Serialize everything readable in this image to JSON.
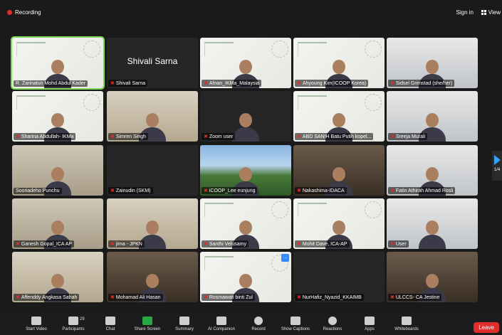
{
  "topbar": {
    "recording_label": "Recording",
    "signin_label": "Sign in",
    "view_label": "View"
  },
  "gallery": {
    "page_indicator": "1/4",
    "participants": [
      {
        "name": "R. Zarinatun Mohd Abdul Kader",
        "bg": "slide",
        "muted": false,
        "active": true
      },
      {
        "name": "Shivali Sarna",
        "bg": "dark",
        "muted": true,
        "big": "Shivali Sarna"
      },
      {
        "name": "Afnan_IKMa_Malaysia",
        "bg": "slide",
        "muted": true
      },
      {
        "name": "Ahyoung Kim(ICOOP Korea)",
        "bg": "slide",
        "muted": true
      },
      {
        "name": "Sidsel Grimstad (she/her)",
        "bg": "room4",
        "muted": true
      },
      {
        "name": "Sharina Abdullah- IKMa",
        "bg": "slide",
        "muted": true
      },
      {
        "name": "Simren Singh",
        "bg": "room2",
        "muted": true
      },
      {
        "name": "Zoom user",
        "bg": "dark",
        "muted": true
      },
      {
        "name": "ABD SANIH Batu Putih kopel...",
        "bg": "slide",
        "muted": true
      },
      {
        "name": "Sreeja Murali",
        "bg": "room4",
        "muted": true
      },
      {
        "name": "Sooriadeho Punchu",
        "bg": "room1",
        "muted": false
      },
      {
        "name": "Zainudin (SKM)",
        "bg": "dark",
        "muted": true
      },
      {
        "name": "iCOOP_Lee eunjung",
        "bg": "outdoor",
        "muted": true
      },
      {
        "name": "Nakashima-IDACA",
        "bg": "room3",
        "muted": true
      },
      {
        "name": "Fatin Athirah Ahmad Rosli",
        "bg": "room4",
        "muted": true
      },
      {
        "name": "Ganesh Gopal_ICA AP",
        "bg": "room1",
        "muted": true
      },
      {
        "name": "jima - JPKN",
        "bg": "room2",
        "muted": true
      },
      {
        "name": "Santhi Velusamy",
        "bg": "slide",
        "muted": true
      },
      {
        "name": "Mohit Dave, ICA-AP",
        "bg": "slide",
        "muted": true
      },
      {
        "name": "User",
        "bg": "room4",
        "muted": true
      },
      {
        "name": "Affenddy Angkasa Sabah",
        "bg": "room2",
        "muted": true
      },
      {
        "name": "Mohamad Ali Hasan",
        "bg": "room3",
        "muted": true
      },
      {
        "name": "Rosmawati binti Zul",
        "bg": "slide",
        "muted": true,
        "emoji": true
      },
      {
        "name": "NurHafiz_Nyazid_KKAIMB",
        "bg": "dark",
        "muted": true,
        "notes": true
      },
      {
        "name": "ULCCS- CA Jestine",
        "bg": "room3",
        "muted": true
      }
    ]
  },
  "toolbar": {
    "items": [
      {
        "label": "Start Video",
        "icon": "video-off-icon"
      },
      {
        "label": "Participants",
        "icon": "participants-icon",
        "count": "29"
      },
      {
        "label": "Chat",
        "icon": "chat-icon"
      },
      {
        "label": "Share Screen",
        "icon": "share-screen-icon"
      },
      {
        "label": "Summary",
        "icon": "summary-icon"
      },
      {
        "label": "AI Companion",
        "icon": "ai-companion-icon"
      },
      {
        "label": "Record",
        "icon": "record-icon"
      },
      {
        "label": "Show Captions",
        "icon": "captions-icon"
      },
      {
        "label": "Reactions",
        "icon": "reactions-icon"
      },
      {
        "label": "Apps",
        "icon": "apps-icon"
      },
      {
        "label": "Whiteboards",
        "icon": "whiteboard-icon"
      }
    ],
    "leave_label": "Leave"
  }
}
